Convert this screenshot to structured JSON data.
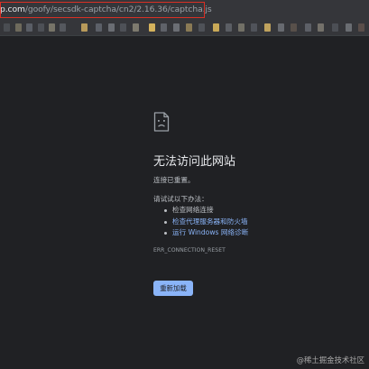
{
  "address_bar": {
    "host": "p.com",
    "path": "/goofy/secsdk-captcha/cn2/2.16.36/captcha.js"
  },
  "error_page": {
    "icon": "sad-page-icon",
    "title": "无法访问此网站",
    "subtitle": "连接已重置。",
    "try_label": "请试试以下办法：",
    "suggestions": [
      "检查网络连接",
      "检查代理服务器和防火墙",
      "运行 Windows 网络诊断"
    ],
    "error_code": "ERR_CONNECTION_RESET",
    "reload_label": "重新加载"
  },
  "watermark": "@稀土掘金技术社区",
  "colors": {
    "background": "#202124",
    "link": "#8ab4f8",
    "highlight_box": "#d93025"
  }
}
